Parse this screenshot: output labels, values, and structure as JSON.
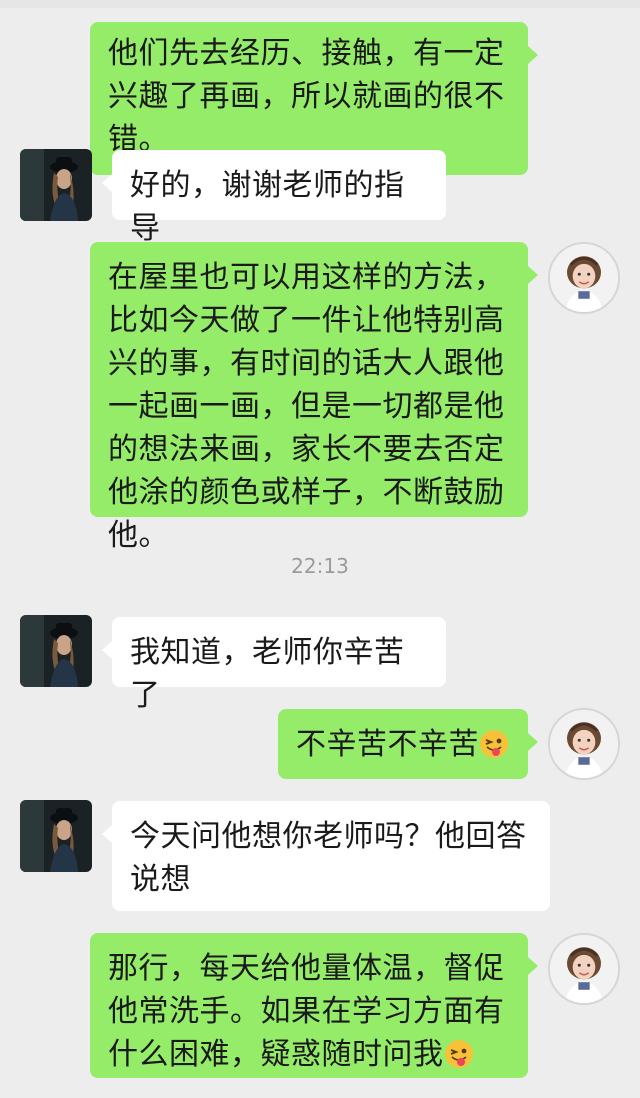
{
  "timestamp": "22:13",
  "messages": [
    {
      "text": "他们先去经历、接触，有一定兴趣了再画，所以就画的很不错。",
      "emoji": null
    },
    {
      "text": "好的，谢谢老师的指导",
      "emoji": null
    },
    {
      "text": "在屋里也可以用这样的方法，比如今天做了一件让他特别高兴的事，有时间的话大人跟他一起画一画，但是一切都是他的想法来画，家长不要去否定他涂的颜色或样子，不断鼓励他。",
      "emoji": null
    },
    {
      "text": "我知道，老师你辛苦了",
      "emoji": null
    },
    {
      "text": "不辛苦不辛苦",
      "emoji": "tongue-wink-emoji"
    },
    {
      "text": "今天问他想你老师吗？他回答说想",
      "emoji": null
    },
    {
      "text": "那行，每天给他量体温，督促他常洗手。如果在学习方面有什么困难，疑惑随时问我",
      "emoji": "tongue-wink-emoji"
    }
  ],
  "colors": {
    "background": "#ededed",
    "sent_bubble": "#95ec69",
    "received_bubble": "#ffffff",
    "timestamp_text": "#9a9a9a"
  },
  "icons": {
    "teacher_avatar": "girl-photo-avatar-icon",
    "parent_avatar": "woman-dark-photo-avatar-icon"
  }
}
